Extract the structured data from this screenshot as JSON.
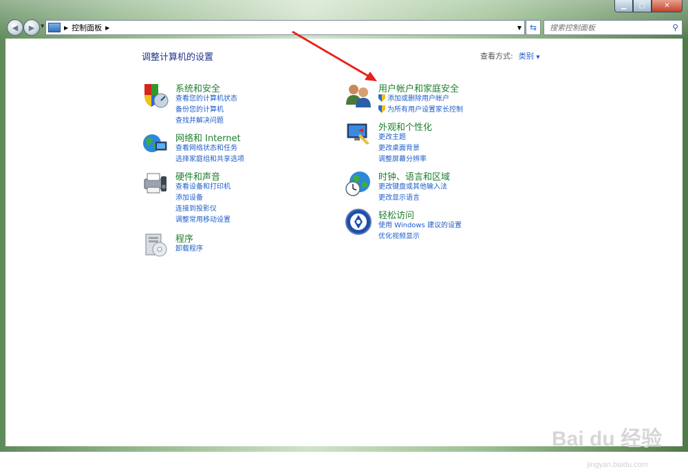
{
  "address": {
    "path": "控制面板"
  },
  "search": {
    "placeholder": "搜索控制面板"
  },
  "page": {
    "title": "调整计算机的设置"
  },
  "viewby": {
    "label": "查看方式:",
    "value": "类别"
  },
  "categories": {
    "system": {
      "title": "系统和安全",
      "links": [
        "查看您的计算机状态",
        "备份您的计算机",
        "查找并解决问题"
      ]
    },
    "network": {
      "title": "网络和 Internet",
      "links": [
        "查看网络状态和任务",
        "选择家庭组和共享选项"
      ]
    },
    "hardware": {
      "title": "硬件和声音",
      "links": [
        "查看设备和打印机",
        "添加设备",
        "连接到投影仪",
        "调整常用移动设置"
      ]
    },
    "programs": {
      "title": "程序",
      "links": [
        "卸载程序"
      ]
    },
    "users": {
      "title": "用户帐户和家庭安全",
      "links": [
        "添加或删除用户帐户",
        "为所有用户设置家长控制"
      ]
    },
    "appearance": {
      "title": "外观和个性化",
      "links": [
        "更改主题",
        "更改桌面背景",
        "调整屏幕分辨率"
      ]
    },
    "clock": {
      "title": "时钟、语言和区域",
      "links": [
        "更改键盘或其他输入法",
        "更改显示语言"
      ]
    },
    "ease": {
      "title": "轻松访问",
      "links": [
        "使用 Windows 建议的设置",
        "优化视频显示"
      ]
    }
  },
  "watermark": {
    "brand": "Bai du 经验",
    "url": "jingyan.baidu.com"
  },
  "colors": {
    "link": "#1e5ec8",
    "category_title": "#1e7e2e",
    "arrow": "#e8211c"
  }
}
